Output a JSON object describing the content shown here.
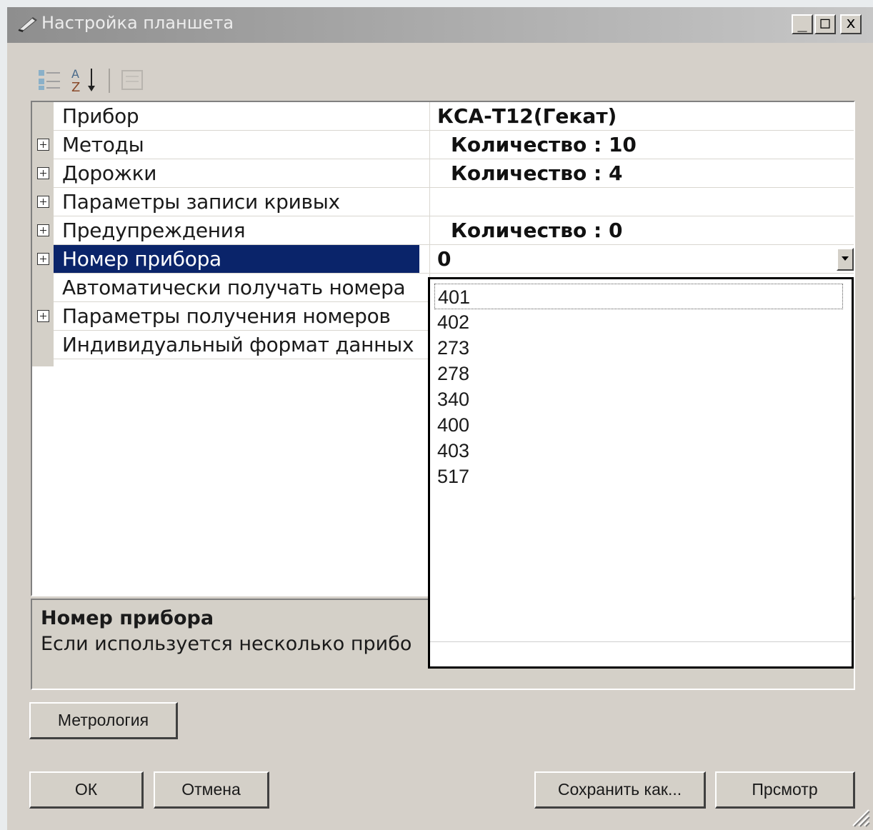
{
  "window": {
    "title": "Настройка планшета"
  },
  "titlebar_buttons": {
    "minimize": "_",
    "maximize": "□",
    "close": "x"
  },
  "toolbar": {
    "icons": [
      "categorized-icon",
      "sort-alpha-icon",
      "property-pages-icon"
    ]
  },
  "properties": [
    {
      "name": "Прибор",
      "value": "КСА-Т12(Гекат)",
      "expandable": false
    },
    {
      "name": "Методы",
      "value": "Количество : 10",
      "expandable": true
    },
    {
      "name": "Дорожки",
      "value": "Количество : 4",
      "expandable": true
    },
    {
      "name": "Параметры записи кривых",
      "value": "",
      "expandable": true
    },
    {
      "name": "Предупреждения",
      "value": "Количество : 0",
      "expandable": true
    },
    {
      "name": "Номер прибора",
      "value": "0",
      "expandable": true,
      "selected": true
    },
    {
      "name": "Автоматически получать номера",
      "value": "",
      "expandable": false
    },
    {
      "name": "Параметры получения номеров",
      "value": "",
      "expandable": true
    },
    {
      "name": "Индивидуальный формат данных",
      "value": "",
      "expandable": false
    }
  ],
  "dropdown": {
    "options": [
      "401",
      "402",
      "273",
      "278",
      "340",
      "400",
      "403",
      "517"
    ],
    "focused_index": 0
  },
  "description": {
    "title": "Номер прибора",
    "text": "Если используется несколько прибо"
  },
  "buttons": {
    "metrology": "Метрология",
    "ok": "ОК",
    "cancel": "Отмена",
    "save_as": "Сохранить как...",
    "preview": "Прсмотр"
  },
  "colors": {
    "selection": "#0a246a",
    "face": "#d4d0c8"
  }
}
